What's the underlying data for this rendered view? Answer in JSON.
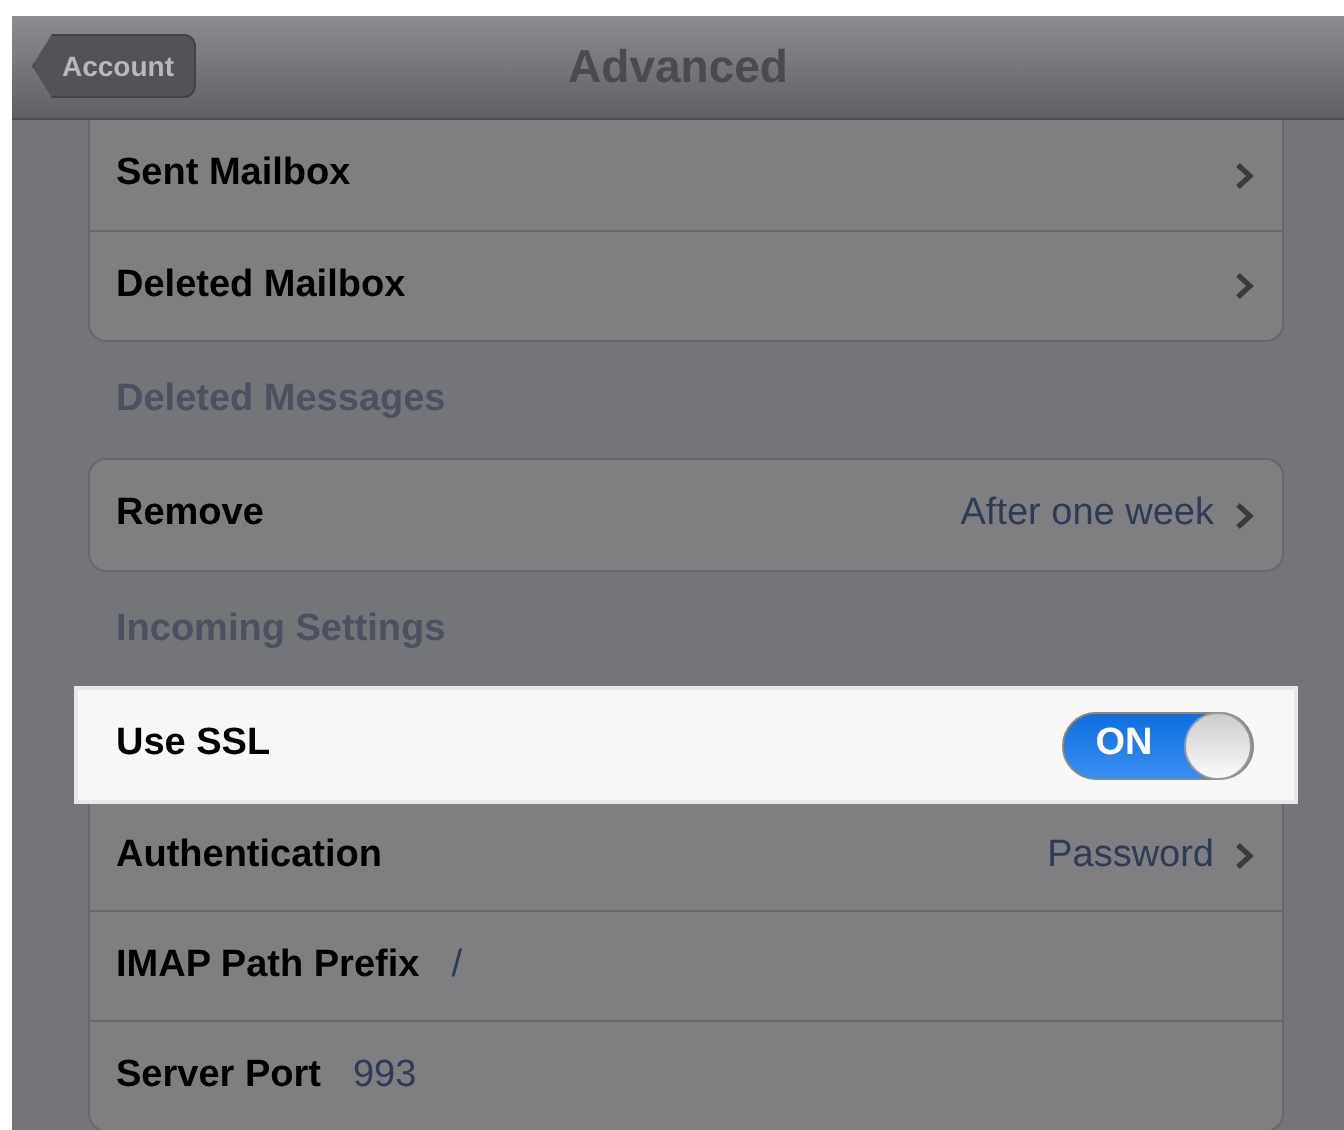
{
  "nav_bar": {
    "back_button": "Account",
    "title": "Advanced"
  },
  "sections": [
    {
      "rows": [
        {
          "kind": "disclosure",
          "label": "Sent Mailbox",
          "highlighted": false
        },
        {
          "kind": "disclosure",
          "label": "Deleted Mailbox",
          "highlighted": false
        }
      ]
    },
    {
      "header": "Deleted Messages",
      "rows": [
        {
          "kind": "disclosure",
          "label": "Remove",
          "value": "After one week",
          "highlighted": false
        }
      ]
    },
    {
      "header": "Incoming Settings",
      "rows": [
        {
          "kind": "switch",
          "label": "Use SSL",
          "switch_text": "ON",
          "on": true,
          "highlighted": true
        },
        {
          "kind": "disclosure",
          "label": "Authentication",
          "value": "Password",
          "highlighted": false
        },
        {
          "kind": "text",
          "label": "IMAP Path Prefix",
          "value": "/",
          "highlighted": false
        },
        {
          "kind": "text",
          "label": "Server Port",
          "value": "993",
          "highlighted": false
        }
      ]
    }
  ]
}
